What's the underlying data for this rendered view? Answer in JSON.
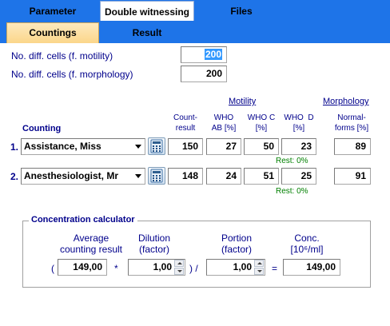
{
  "tabs": {
    "top": [
      "Parameter",
      "Double witnessing",
      "Files"
    ],
    "sub": [
      "Countings",
      "Result"
    ]
  },
  "settings": {
    "motility_label": "No. diff. cells (f. motility)",
    "motility_value": "200",
    "morphology_label": "No. diff. cells (f. morphology)",
    "morphology_value": "200"
  },
  "headers": {
    "motility_group": "Motility",
    "morphology_group": "Morphology",
    "counting": "Counting",
    "count_result": "Count-\nresult",
    "who_ab": "WHO\nAB [%]",
    "who_c": "WHO C\n[%]",
    "who_d": "WHO  D\n[%]",
    "normal_forms": "Normal-\nforms [%]"
  },
  "rows": [
    {
      "num": "1.",
      "name": "Assistance, Miss",
      "count": "150",
      "ab": "27",
      "c": "50",
      "d": "23",
      "rest": "Rest: 0%",
      "normal": "89"
    },
    {
      "num": "2.",
      "name": "Anesthesiologist, Mr",
      "count": "148",
      "ab": "24",
      "c": "51",
      "d": "25",
      "rest": "Rest: 0%",
      "normal": "91"
    }
  ],
  "calculator": {
    "title": "Concentration calculator",
    "avg_label": "Average\ncounting result",
    "dilution_label": "Dilution\n(factor)",
    "portion_label": "Portion\n(factor)",
    "conc_label": "Conc.\n[10⁶/ml]",
    "avg_value": "149,00",
    "dilution_value": "1,00",
    "portion_value": "1,00",
    "conc_value": "149,00",
    "open_paren": "(",
    "times": "*",
    "divide": ") /",
    "equals": "="
  }
}
